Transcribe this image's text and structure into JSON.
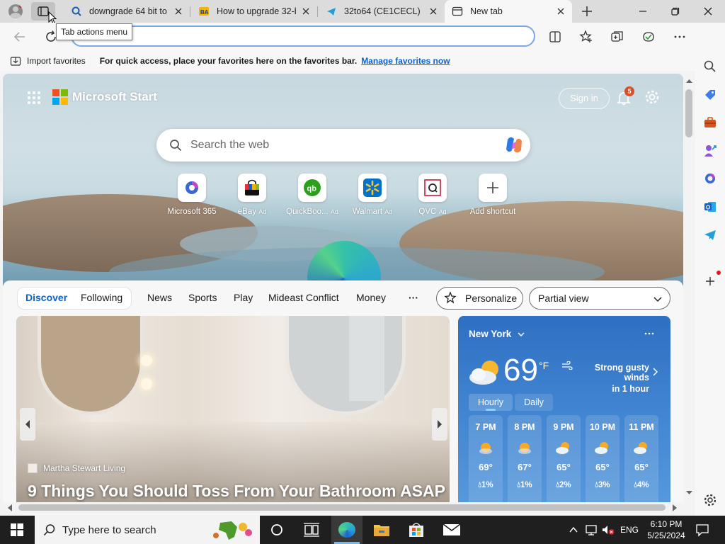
{
  "tabs": [
    {
      "title": "downgrade 64 bit to"
    },
    {
      "title": "How to upgrade 32-b"
    },
    {
      "title": "32to64 (CE1CECL)"
    },
    {
      "title": "New tab"
    }
  ],
  "tooltip": "Tab actions menu",
  "favorites_bar": {
    "import": "Import favorites",
    "message": "For quick access, place your favorites here on the favorites bar.",
    "manage_link": "Manage favorites now"
  },
  "start": {
    "brand": "Microsoft Start",
    "sign_in": "Sign in",
    "notification_count": "5",
    "search_placeholder": "Search the web",
    "shortcuts": [
      {
        "label": "Microsoft 365",
        "ad": ""
      },
      {
        "label": "eBay",
        "ad": "Ad"
      },
      {
        "label": "QuickBoo...",
        "ad": "Ad"
      },
      {
        "label": "Walmart",
        "ad": "Ad"
      },
      {
        "label": "QVC",
        "ad": "Ad"
      },
      {
        "label": "Add shortcut",
        "ad": ""
      }
    ]
  },
  "feed_nav": {
    "items": [
      "Discover",
      "Following",
      "News",
      "Sports",
      "Play",
      "Mideast Conflict",
      "Money"
    ],
    "more": "···",
    "personalize": "Personalize",
    "view": "Partial view"
  },
  "article": {
    "source": "Martha Stewart Living",
    "headline": "9 Things You Should Toss From Your Bathroom ASAP"
  },
  "weather": {
    "location": "New York",
    "temp": "69",
    "unit": "°F",
    "alert_line1": "Strong gusty winds",
    "alert_line2": "in 1 hour",
    "tabs": [
      "Hourly",
      "Daily"
    ],
    "hours": [
      {
        "time": "7 PM",
        "temp": "69°",
        "precip": "1%"
      },
      {
        "time": "8 PM",
        "temp": "67°",
        "precip": "1%"
      },
      {
        "time": "9 PM",
        "temp": "65°",
        "precip": "2%"
      },
      {
        "time": "10 PM",
        "temp": "65°",
        "precip": "3%"
      },
      {
        "time": "11 PM",
        "temp": "65°",
        "precip": "4%"
      }
    ]
  },
  "taskbar": {
    "search_placeholder": "Type here to search",
    "language": "ENG",
    "time": "6:10 PM",
    "date": "5/25/2024"
  }
}
